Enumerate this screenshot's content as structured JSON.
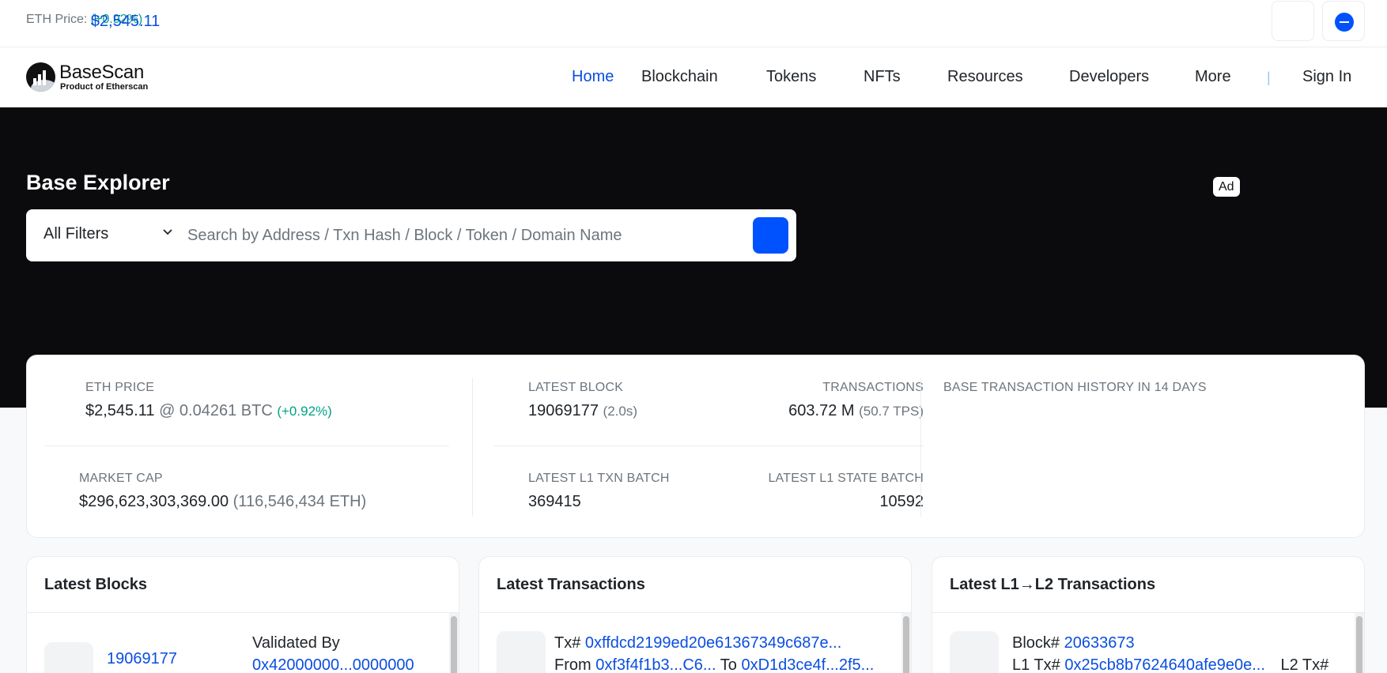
{
  "topbar": {
    "eth_price_label": "ETH Price:",
    "eth_price_value": "$2,545.11",
    "eth_price_change": "(+0.92%)"
  },
  "header": {
    "logo_name": "BaseScan",
    "logo_sub": "Product of Etherscan",
    "nav": {
      "home": "Home",
      "blockchain": "Blockchain",
      "tokens": "Tokens",
      "nfts": "NFTs",
      "resources": "Resources",
      "developers": "Developers",
      "more": "More",
      "separator": "|",
      "sign_in": "Sign In"
    }
  },
  "hero": {
    "title": "Base Explorer",
    "filter_label": "All Filters",
    "search_placeholder": "Search by Address / Txn Hash / Block / Token / Domain Name",
    "ad_label": "Ad"
  },
  "stats": {
    "eth_price": {
      "label": "ETH PRICE",
      "value": "$2,545.11",
      "btc": "@ 0.04261 BTC",
      "change": "(+0.92%)"
    },
    "market_cap": {
      "label": "MARKET CAP",
      "value": "$296,623,303,369.00",
      "eth": "(116,546,434 ETH)"
    },
    "latest_block": {
      "label": "LATEST BLOCK",
      "value": "19069177",
      "time": "(2.0s)"
    },
    "transactions": {
      "label": "TRANSACTIONS",
      "value": "603.72 M",
      "tps": "(50.7 TPS)"
    },
    "l1_txn_batch": {
      "label": "LATEST L1 TXN BATCH",
      "value": "369415"
    },
    "l1_state_batch": {
      "label": "LATEST L1 STATE BATCH",
      "value": "10592"
    },
    "history": {
      "label": "BASE TRANSACTION HISTORY IN 14 DAYS"
    }
  },
  "cards": {
    "blocks": {
      "title": "Latest Blocks",
      "block_number": "19069177",
      "validated_by_label": "Validated By",
      "validator": "0x42000000...0000000"
    },
    "transactions": {
      "title": "Latest Transactions",
      "tx_label": "Tx#",
      "tx_hash": "0xffdcd2199ed20e61367349c687e...",
      "from_label": "From",
      "from_addr": "0xf3f4f1b3...C6...",
      "to_label": "To",
      "to_addr": "0xD1d3ce4f...2f5..."
    },
    "l1l2": {
      "title": "Latest L1→L2 Transactions",
      "block_label": "Block#",
      "block_number": "20633673",
      "l1_label": "L1 Tx#",
      "l1_hash": "0x25cb8b7624640afe9e0e...",
      "l2_label": "L2 Tx#"
    }
  },
  "colors": {
    "link": "#0a4ee0",
    "brand": "#0052ff",
    "positive": "#00a186",
    "hero_bg": "#0b0b0d"
  }
}
